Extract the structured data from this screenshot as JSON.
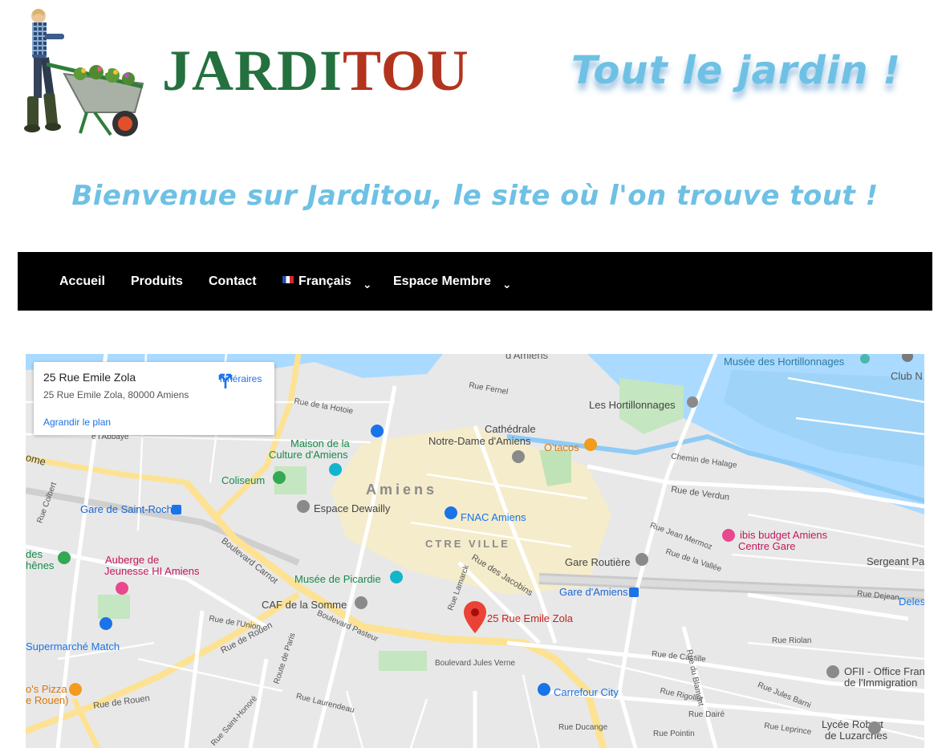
{
  "header": {
    "logo_part1": "JARDI",
    "logo_part2": "TOU",
    "tagline": "Tout le jardin !",
    "welcome": "Bienvenue sur Jarditou, le site où l'on trouve tout !"
  },
  "nav": {
    "items": [
      {
        "label": "Accueil"
      },
      {
        "label": "Produits"
      },
      {
        "label": "Contact"
      },
      {
        "label": "Français"
      },
      {
        "label": "Espace Membre"
      }
    ]
  },
  "map": {
    "card": {
      "title": "25 Rue Emile Zola",
      "address": "25 Rue Emile Zola, 80000 Amiens",
      "directions": "Itinéraires",
      "enlarge": "Agrandir le plan"
    },
    "pin_label": "25 Rue Emile Zola",
    "city": "Amiens",
    "district": "CTRE VILLE",
    "places": {
      "hortillonnages_museum": "Musée des Hortillonnages",
      "club": "Club N",
      "hortillonnages": "Les Hortillonnages",
      "cathedral1": "Cathédrale",
      "cathedral2": "Notre-Dame d'Amiens",
      "otacos": "O'tacos",
      "maison1": "Maison de la",
      "maison2": "Culture d'Amiens",
      "coliseum": "Coliseum",
      "espace": "Espace Dewailly",
      "fnac": "FNAC Amiens",
      "gare_saint_roch": "Gare de Saint-Roch",
      "ibis1": "ibis budget Amiens",
      "ibis2": "Centre Gare",
      "sergeant": "Sergeant Pa",
      "gare_routiere": "Gare Routière",
      "auberge1": "Auberge de",
      "auberge2": "Jeunesse HI Amiens",
      "musee_picardie": "Musée de Picardie",
      "gare_amiens": "Gare d'Amiens",
      "caf": "CAF de la Somme",
      "deles": "Deles",
      "supermarche": "Supermarché Match",
      "ofii1": "OFII - Office Fran",
      "ofii2": "de l'Immigration",
      "pizza1": "o's Pizza",
      "pizza2": "e Rouen)",
      "carrefour": "Carrefour City",
      "lycee1": "Lycée Robert",
      "lycee2": "de Luzarches",
      "damiens": "d'Amiens",
      "des1": "des",
      "des2": "hênes",
      "ome": "ome"
    },
    "streets": {
      "boulevard_carnot": "Boulevard Carnot",
      "rue_de_rouen": "Rue de Rouen",
      "rue_de_rouen2": "Rue de Rouen",
      "rue_jacobins": "Rue des Jacobins",
      "rue_verdun": "Rue de Verdun",
      "rue_hotoie": "Rue de la Hotoie",
      "rue_abbaye": "e l'Abbaye",
      "rue_fernel": "Rue Fernel",
      "jules_verne": "Boulevard Jules Verne",
      "rue_ducange": "Rue Ducange",
      "rue_pointin": "Rue Pointin",
      "rue_jules_barni": "Rue Jules Barni",
      "rue_riolan": "Rue Riolan",
      "rue_dejean": "Rue Dejean",
      "rue_de_la_vallee": "Rue de la Vallée",
      "rue_castille": "Rue de Castille",
      "rue_dairé": "Rue Dairé",
      "rue_lamarck": "Rue Lamarck",
      "rue_du_blamont": "Rue du Blamont",
      "chemin_halage": "Chemin de Halage",
      "rue_union": "Rue de l'Union",
      "boulevard_pasteur": "Boulevard Pasteur",
      "route_paris": "Route de Paris",
      "rue_laurendeau": "Rue Laurendeau",
      "rue_saint_honore": "Rue Saint-Honoré",
      "rue_colbert": "Rue Colbert",
      "rue_rigollot": "Rue Rigollot",
      "rue_leprince": "Rue Leprince",
      "rue_jean_mermoz": "Rue Jean Mermoz"
    }
  },
  "colors": {
    "logo_green": "#25703f",
    "logo_red": "#b2341f",
    "tagline_blue": "#6ec1e4",
    "nav_bg": "#000000",
    "map_link": "#1a73e8",
    "pin_red": "#ea4335"
  }
}
